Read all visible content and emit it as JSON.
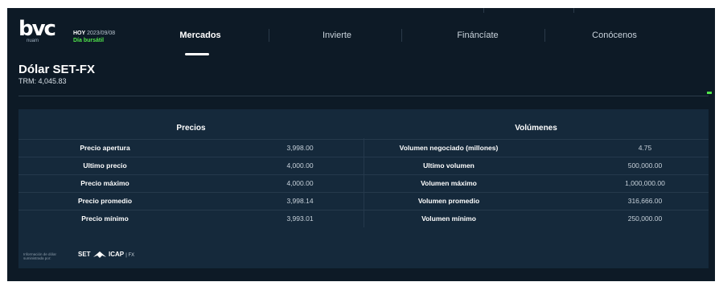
{
  "header": {
    "logo_text": "bvc",
    "logo_sub": "nuam",
    "today_label": "HOY",
    "today_date": "2023/09/08",
    "today_status": "Día bursátil",
    "nav": [
      {
        "label": "Mercados",
        "active": true
      },
      {
        "label": "Invierte",
        "active": false
      },
      {
        "label": "Fináncíate",
        "active": false
      },
      {
        "label": "Conócenos",
        "active": false
      }
    ]
  },
  "page": {
    "title": "Dólar SET-FX",
    "trm": "TRM: 4,045.83"
  },
  "table": {
    "left_header": "Precios",
    "right_header": "Volúmenes",
    "rows": [
      {
        "price_label": "Precio apertura",
        "price_value": "3,998.00",
        "volume_label": "Volumen negociado (millones)",
        "volume_value": "4.75"
      },
      {
        "price_label": "Ultimo precio",
        "price_value": "4,000.00",
        "volume_label": "Ultimo volumen",
        "volume_value": "500,000.00"
      },
      {
        "price_label": "Precio máximo",
        "price_value": "4,000.00",
        "volume_label": "Volumen máximo",
        "volume_value": "1,000,000.00"
      },
      {
        "price_label": "Precio promedio",
        "price_value": "3,998.14",
        "volume_label": "Volumen promedio",
        "volume_value": "316,666.00"
      },
      {
        "price_label": "Precio mínimo",
        "price_value": "3,993.01",
        "volume_label": "Volumen mínimo",
        "volume_value": "250,000.00"
      }
    ]
  },
  "footer": {
    "small_text": "Información de dólar suministrada por:",
    "brand_left": "SET",
    "brand_right": "ICAP",
    "brand_fx": "| FX"
  },
  "colors": {
    "background": "#0d1a26",
    "panel": "#15293b",
    "accent_green": "#4fe34a"
  }
}
